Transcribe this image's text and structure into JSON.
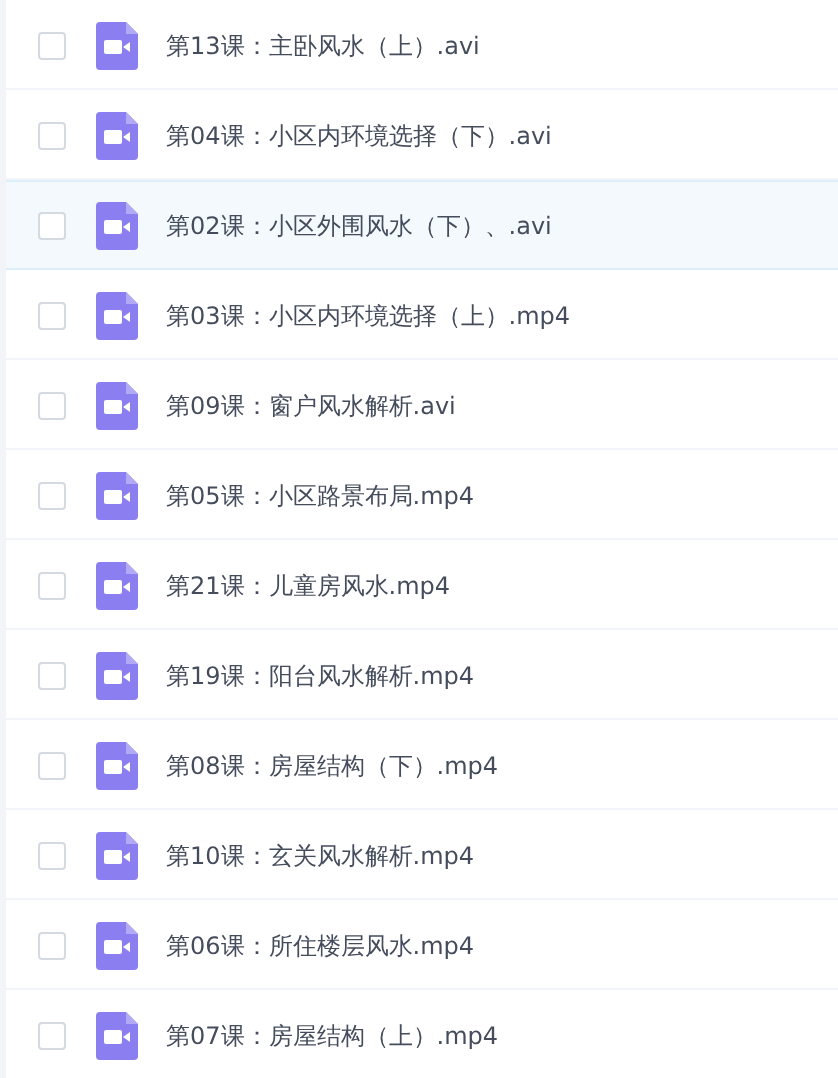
{
  "files": [
    {
      "name": "第13课：主卧风水（上）.avi",
      "checked": false,
      "highlighted": false
    },
    {
      "name": "第04课：小区内环境选择（下）.avi",
      "checked": false,
      "highlighted": false
    },
    {
      "name": "第02课：小区外围风水（下）、.avi",
      "checked": false,
      "highlighted": true
    },
    {
      "name": "第03课：小区内环境选择（上）.mp4",
      "checked": false,
      "highlighted": false
    },
    {
      "name": "第09课：窗户风水解析.avi",
      "checked": false,
      "highlighted": false
    },
    {
      "name": "第05课：小区路景布局.mp4",
      "checked": false,
      "highlighted": false
    },
    {
      "name": "第21课：儿童房风水.mp4",
      "checked": false,
      "highlighted": false
    },
    {
      "name": "第19课：阳台风水解析.mp4",
      "checked": false,
      "highlighted": false
    },
    {
      "name": "第08课：房屋结构（下）.mp4",
      "checked": false,
      "highlighted": false
    },
    {
      "name": "第10课：玄关风水解析.mp4",
      "checked": false,
      "highlighted": false
    },
    {
      "name": "第06课：所住楼层风水.mp4",
      "checked": false,
      "highlighted": false
    },
    {
      "name": "第07课：房屋结构（上）.mp4",
      "checked": false,
      "highlighted": false
    }
  ]
}
